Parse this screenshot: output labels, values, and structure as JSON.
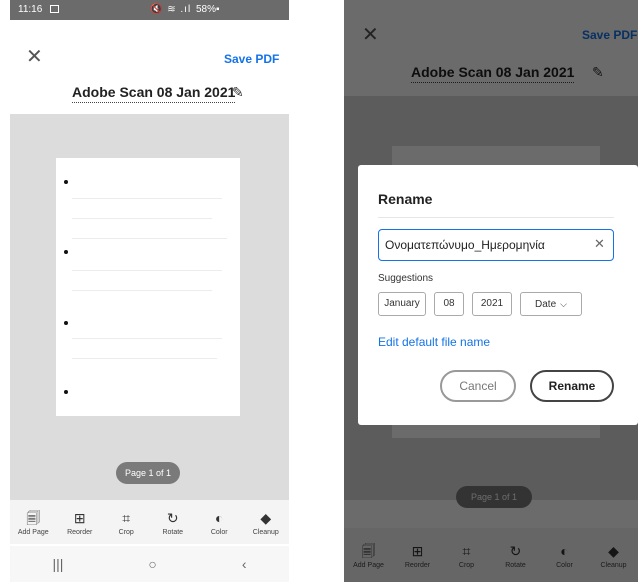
{
  "status_bar": {
    "time": "11:16",
    "icons": "🔇 ≋ .ıl",
    "battery": "58%▪"
  },
  "header": {
    "close": "✕",
    "save_pdf": "Save PDF",
    "title": "Adobe Scan 08 Jan 2021",
    "edit": "✎"
  },
  "page_indicator": "Page 1 of 1",
  "toolbar": [
    {
      "icon": "add-page-icon",
      "glyph": "🗐",
      "label": "Add Page"
    },
    {
      "icon": "reorder-icon",
      "glyph": "⊞",
      "label": "Reorder"
    },
    {
      "icon": "crop-icon",
      "glyph": "⌗",
      "label": "Crop"
    },
    {
      "icon": "rotate-icon",
      "glyph": "↻",
      "label": "Rotate"
    },
    {
      "icon": "color-icon",
      "glyph": "◐",
      "label": "Color"
    },
    {
      "icon": "cleanup-icon",
      "glyph": "◆",
      "label": "Cleanup"
    }
  ],
  "navbar": {
    "recents": "|||",
    "home": "○",
    "back": "‹"
  },
  "dialog": {
    "title": "Rename",
    "input_value": "Ονοματεπώνυμο_Ημερομηνία",
    "clear": "✕",
    "suggestions_label": "Suggestions",
    "chips": [
      "January",
      "08",
      "2021",
      "Date"
    ],
    "chevron": "⌵",
    "edit_default": "Edit default file name",
    "cancel": "Cancel",
    "rename": "Rename"
  },
  "colors": {
    "accent": "#1473e6",
    "status_bar": "#6b6b6b",
    "canvas": "#dcdcdc"
  }
}
